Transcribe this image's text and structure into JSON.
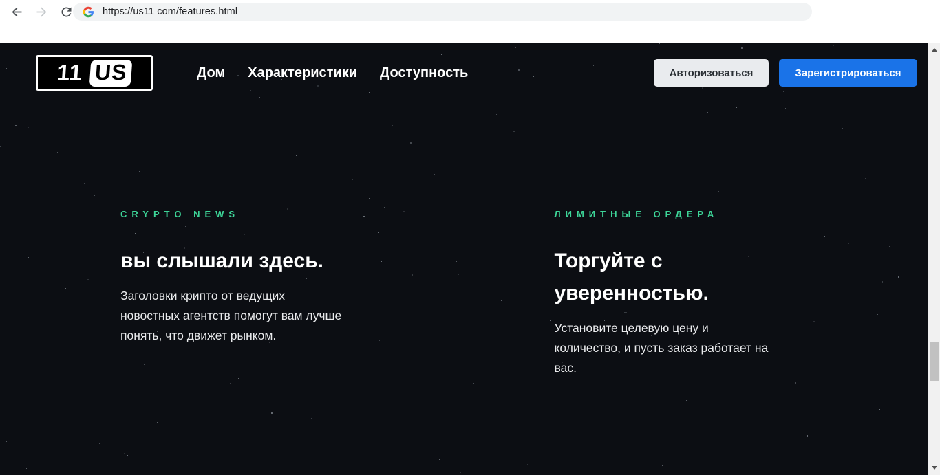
{
  "browser": {
    "url": "https://us11 com/features.html",
    "icons": {
      "back": "back-arrow-icon",
      "forward": "forward-arrow-icon",
      "reload": "reload-icon",
      "site": "google-g-icon"
    }
  },
  "header": {
    "logo": {
      "number": "11",
      "letters": "US"
    },
    "nav": [
      {
        "label": "Дом"
      },
      {
        "label": "Характеристики"
      },
      {
        "label": "Доступность"
      }
    ],
    "auth": {
      "login_label": "Авторизоваться",
      "register_label": "Зарегистрироваться"
    }
  },
  "features": [
    {
      "eyebrow": "CRYPTO NEWS",
      "title": "вы слышали здесь.",
      "body": "Заголовки крипто от ведущих\nновостных агентств помогут вам лучше\nпонять, что движет рынком."
    },
    {
      "eyebrow": "ЛИМИТНЫЕ ОРДЕРА",
      "title": "Торгуйте с\nуверенностью.",
      "body": "Установите целевую цену и\nколичество, и пусть заказ работает на\nвас."
    }
  ],
  "colors": {
    "accent_green": "#3dd598",
    "accent_blue": "#1a73e8",
    "page_background": "#0c0e13",
    "login_button_background": "#e9ebee"
  }
}
